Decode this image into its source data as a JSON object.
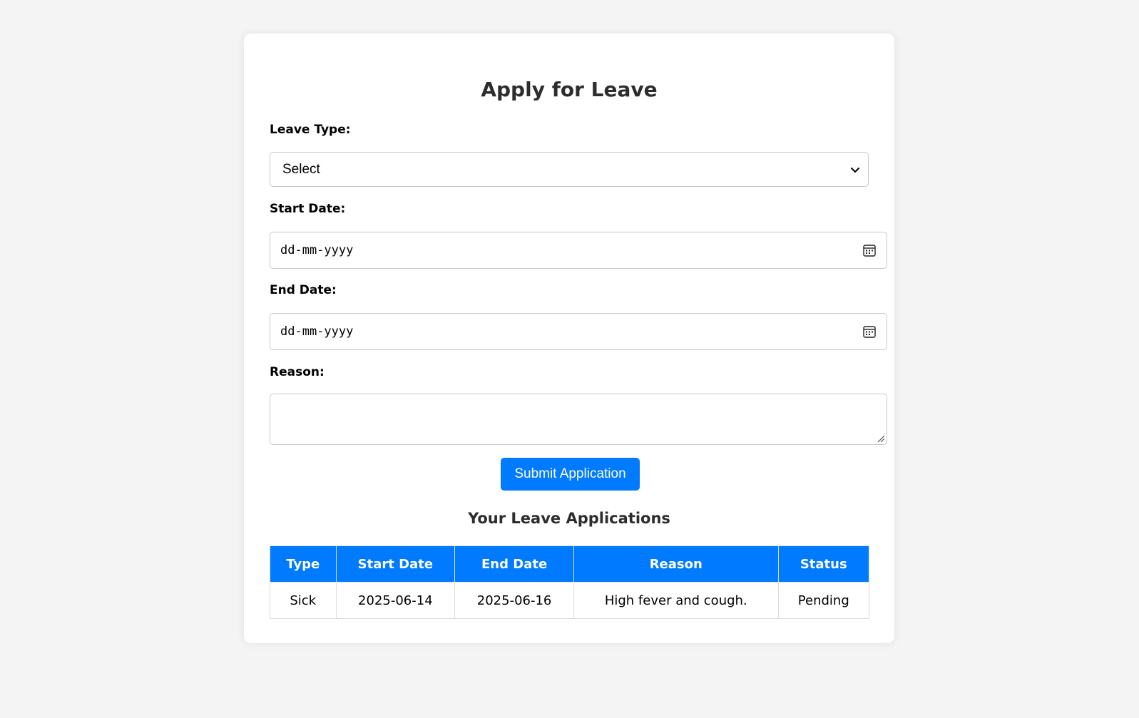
{
  "page": {
    "title": "Apply for Leave"
  },
  "form": {
    "leave_type_label": "Leave Type:",
    "leave_type_value": "Select",
    "start_date_label": "Start Date:",
    "start_date_placeholder": "dd-mm-yyyy",
    "end_date_label": "End Date:",
    "end_date_placeholder": "dd-mm-yyyy",
    "reason_label": "Reason:",
    "reason_value": "",
    "submit_label": "Submit Application"
  },
  "applications": {
    "title": "Your Leave Applications",
    "headers": {
      "type": "Type",
      "start_date": "Start Date",
      "end_date": "End Date",
      "reason": "Reason",
      "status": "Status"
    },
    "rows": [
      {
        "type": "Sick",
        "start_date": "2025-06-14",
        "end_date": "2025-06-16",
        "reason": "High fever and cough.",
        "status": "Pending"
      }
    ]
  },
  "colors": {
    "accent": "#007bff",
    "background": "#f4f4f4",
    "card": "#ffffff"
  }
}
